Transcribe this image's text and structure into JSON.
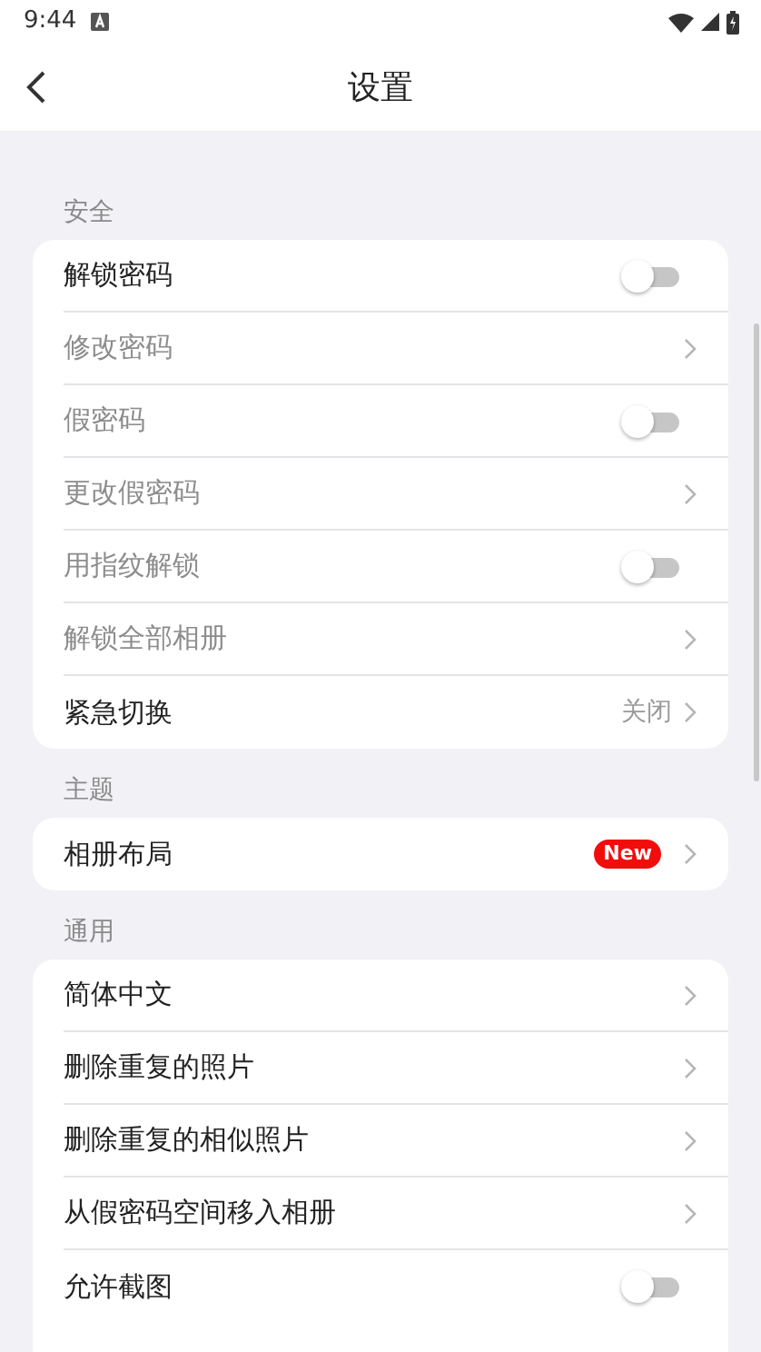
{
  "status_bar": {
    "time": "9:44"
  },
  "header": {
    "title": "设置"
  },
  "sections": [
    {
      "label": "安全",
      "rows": [
        {
          "kind": "toggle",
          "label": "解锁密码",
          "disabled": false,
          "on": false
        },
        {
          "kind": "link",
          "label": "修改密码",
          "disabled": true
        },
        {
          "kind": "toggle",
          "label": "假密码",
          "disabled": true,
          "on": false
        },
        {
          "kind": "link",
          "label": "更改假密码",
          "disabled": true
        },
        {
          "kind": "toggle",
          "label": "用指纹解锁",
          "disabled": true,
          "on": false
        },
        {
          "kind": "link",
          "label": "解锁全部相册",
          "disabled": true
        },
        {
          "kind": "link",
          "label": "紧急切换",
          "disabled": false,
          "value": "关闭"
        }
      ]
    },
    {
      "label": "主题",
      "rows": [
        {
          "kind": "link",
          "label": "相册布局",
          "disabled": false,
          "badge": "New"
        }
      ]
    },
    {
      "label": "通用",
      "rows": [
        {
          "kind": "link",
          "label": "简体中文",
          "disabled": false
        },
        {
          "kind": "link",
          "label": "删除重复的照片",
          "disabled": false
        },
        {
          "kind": "link",
          "label": "删除重复的相似照片",
          "disabled": false
        },
        {
          "kind": "link",
          "label": "从假密码空间移入相册",
          "disabled": false
        },
        {
          "kind": "toggle",
          "label": "允许截图",
          "disabled": false,
          "on": false
        }
      ]
    }
  ]
}
